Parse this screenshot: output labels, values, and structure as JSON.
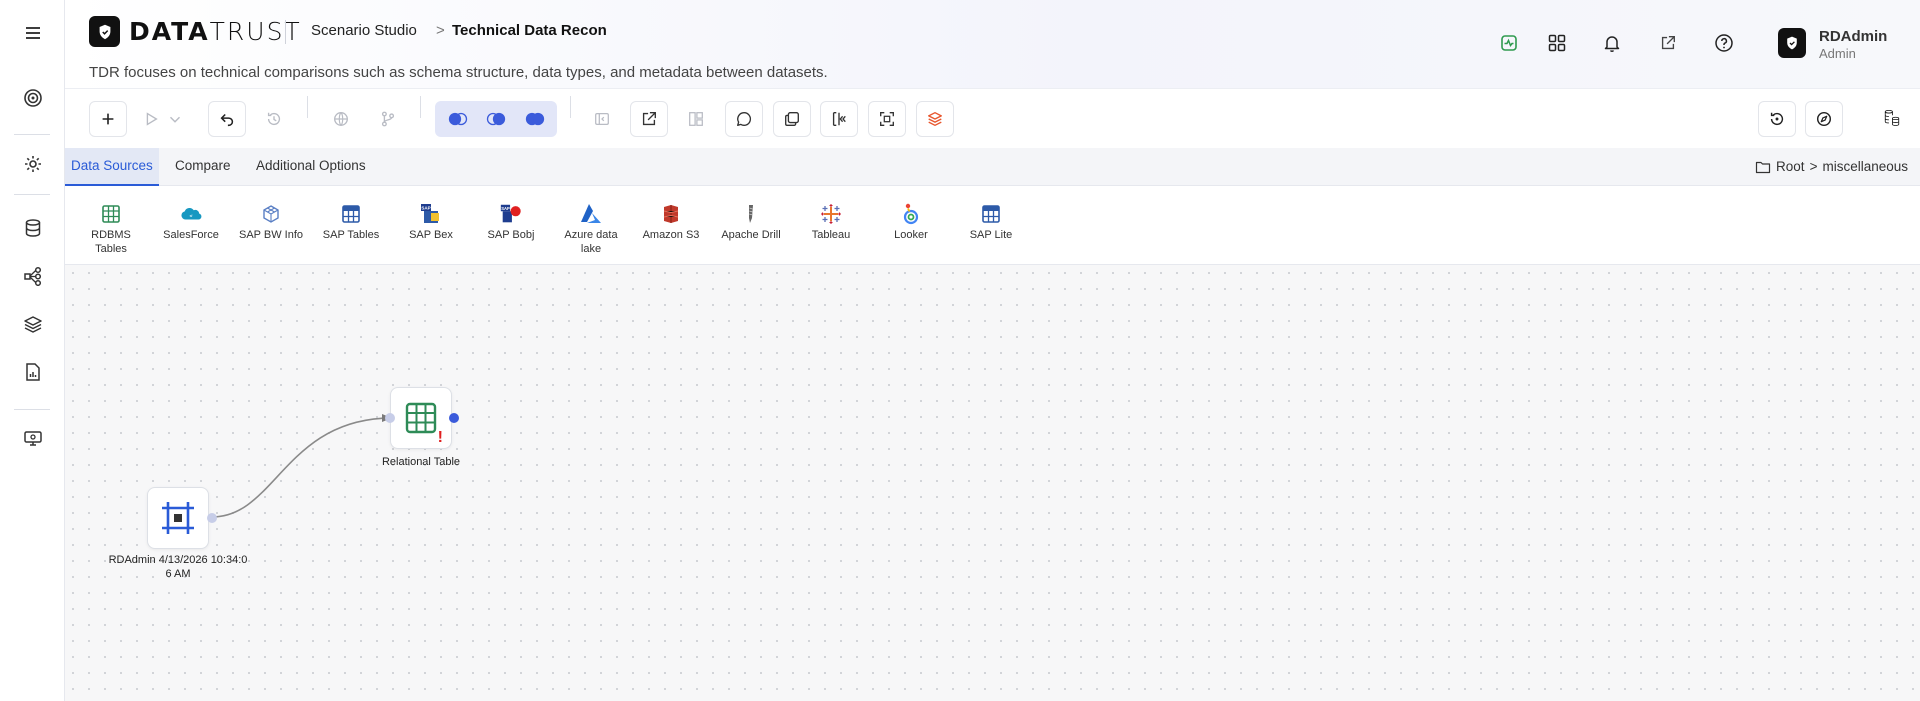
{
  "brand": {
    "logo_bold": "DATA",
    "logo_light": "TRUST"
  },
  "breadcrumb": {
    "studio": "Scenario Studio",
    "separator": ">",
    "current": "Technical Data Recon"
  },
  "description": "TDR focuses on technical comparisons such as schema structure, data types, and metadata between datasets.",
  "header_icons": [
    "activity-icon",
    "apps-grid-icon",
    "bell-icon",
    "external-link-icon",
    "help-icon"
  ],
  "user": {
    "name": "RDAdmin",
    "role": "Admin"
  },
  "tabs": [
    {
      "label": "Data Sources",
      "active": true
    },
    {
      "label": "Compare",
      "active": false
    },
    {
      "label": "Additional Options",
      "active": false
    }
  ],
  "path": {
    "root": "Root",
    "separator": ">",
    "folder": "miscellaneous"
  },
  "sources": [
    {
      "label": "RDBMS Tables",
      "icon": "table-grid-icon",
      "color": "#2e8b57"
    },
    {
      "label": "SalesForce",
      "icon": "salesforce-cloud-icon",
      "color": "#1798c1"
    },
    {
      "label": "SAP BW Info",
      "icon": "cube-icon",
      "color": "#5a7fc4"
    },
    {
      "label": "SAP Tables",
      "icon": "table-grid-icon",
      "color": "#2d5aa8"
    },
    {
      "label": "SAP Bex",
      "icon": "sap-bex-icon",
      "color": "#1e3d8f"
    },
    {
      "label": "SAP Bobj",
      "icon": "sap-bobj-icon",
      "color": "#1e3d8f"
    },
    {
      "label": "Azure data lake",
      "icon": "azure-icon",
      "color": "#1f62c6"
    },
    {
      "label": "Amazon S3",
      "icon": "s3-bucket-icon",
      "color": "#c0392b"
    },
    {
      "label": "Apache Drill",
      "icon": "drill-icon",
      "color": "#666666"
    },
    {
      "label": "Tableau",
      "icon": "tableau-icon",
      "color": "#e8762d"
    },
    {
      "label": "Looker",
      "icon": "looker-icon",
      "color": "#4285f4"
    },
    {
      "label": "SAP Lite",
      "icon": "table-grid-icon",
      "color": "#2d5aa8"
    }
  ],
  "nodes": {
    "relational": {
      "label": "Relational Table",
      "warning": "!"
    },
    "origin": {
      "label_line1": "RDAdmin 4/13/2026 10:34:0",
      "label_line2": "6 AM"
    }
  },
  "colors": {
    "accent": "#2a5bd7",
    "toggle_bg": "#e2e6f8",
    "warning": "#e02020"
  }
}
